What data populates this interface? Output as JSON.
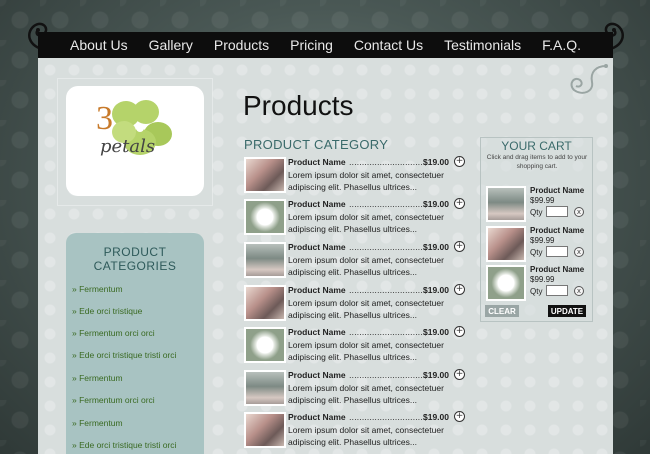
{
  "nav": {
    "items": [
      "About Us",
      "Gallery",
      "Products",
      "Pricing",
      "Contact Us",
      "Testimonials",
      "F.A.Q."
    ]
  },
  "logo": {
    "numeral": "3",
    "word": "petals"
  },
  "sidebar": {
    "title": "PRODUCT CATEGORIES",
    "items": [
      "» Fermentum",
      "» Ede orci tristique",
      "» Fermentum orci orci",
      "» Ede orci tristique tristi orci",
      "» Fermentum",
      "» Fermentum orci orci",
      "» Fermentum",
      "» Ede orci tristique tristi orci"
    ]
  },
  "main": {
    "title": "Products",
    "category": "PRODUCT CATEGORY",
    "products": [
      {
        "name": "Product Name",
        "dots": "...............................",
        "price": "$19.00",
        "desc": "Lorem ipsum dolor sit amet, consectetuer adipiscing elit. Phasellus ultrices...",
        "image": "girl"
      },
      {
        "name": "Product Name",
        "dots": "...............................",
        "price": "$19.00",
        "desc": "Lorem ipsum dolor sit amet, consectetuer adipiscing elit. Phasellus ultrices...",
        "image": "flower"
      },
      {
        "name": "Product Name",
        "dots": "...............................",
        "price": "$19.00",
        "desc": "Lorem ipsum dolor sit amet, consectetuer adipiscing elit. Phasellus ultrices...",
        "image": "scene"
      },
      {
        "name": "Product Name",
        "dots": "...............................",
        "price": "$19.00",
        "desc": "Lorem ipsum dolor sit amet, consectetuer adipiscing elit. Phasellus ultrices...",
        "image": "girl"
      },
      {
        "name": "Product Name",
        "dots": "...............................",
        "price": "$19.00",
        "desc": "Lorem ipsum dolor sit amet, consectetuer adipiscing elit. Phasellus ultrices...",
        "image": "flower"
      },
      {
        "name": "Product Name",
        "dots": "...............................",
        "price": "$19.00",
        "desc": "Lorem ipsum dolor sit amet, consectetuer adipiscing elit. Phasellus ultrices...",
        "image": "scene"
      },
      {
        "name": "Product Name",
        "dots": "...............................",
        "price": "$19.00",
        "desc": "Lorem ipsum dolor sit amet, consectetuer adipiscing elit. Phasellus ultrices...",
        "image": "girl"
      }
    ]
  },
  "cart": {
    "title": "YOUR CART",
    "subtitle": "Click and drag items to add to your shopping cart.",
    "qty_label": "Qty",
    "items": [
      {
        "name": "Product Name",
        "price": "$99.99",
        "qty": "",
        "image": "scene"
      },
      {
        "name": "Product Name",
        "price": "$99.99",
        "qty": "",
        "image": "girl"
      },
      {
        "name": "Product Name",
        "price": "$99.99",
        "qty": "",
        "image": "flower"
      }
    ],
    "clear_label": "CLEAR",
    "update_label": "UPDATE"
  },
  "colors": {
    "accent_teal": "#3a6a6a",
    "category_panel": "#a8c3c2",
    "category_link": "#3a6a22",
    "nav_bg": "#0d0d0d",
    "logo_green": "#b5d36a",
    "logo_orange": "#c87a2a"
  }
}
